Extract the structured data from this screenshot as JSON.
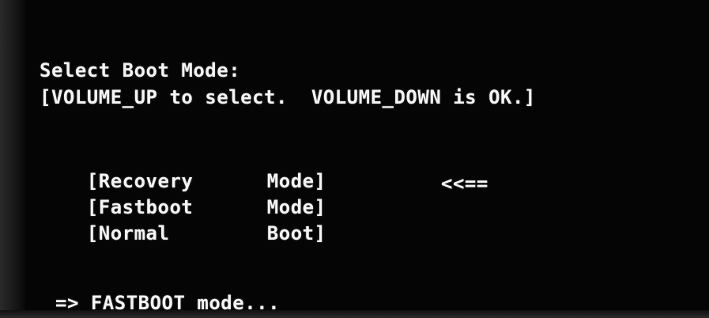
{
  "header": {
    "title": "Select Boot Mode:",
    "hint": "[VOLUME_UP to select.  VOLUME_DOWN is OK.]"
  },
  "menu": {
    "items": [
      {
        "name": "[Recovery",
        "mode": "Mode]"
      },
      {
        "name": "[Fastboot",
        "mode": "Mode]"
      },
      {
        "name": "[Normal",
        "mode": "Boot]"
      }
    ],
    "selected_index": 1,
    "selection_marker": "<<=="
  },
  "status": {
    "text": "=> FASTBOOT mode..."
  }
}
